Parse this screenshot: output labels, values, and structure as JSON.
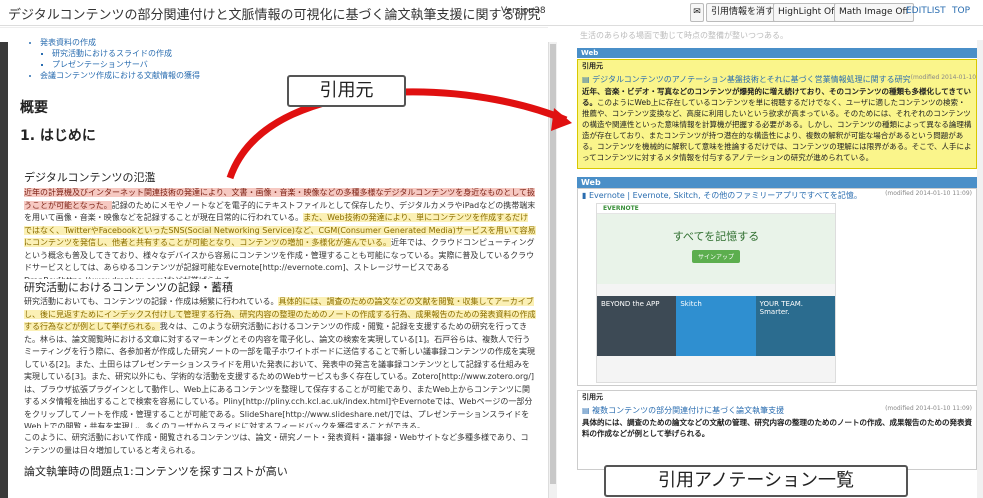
{
  "header": {
    "title": "デジタルコンテンツの部分関連付けと文脈情報の可視化に基づく論文執筆支援に関する研究",
    "version": "Version38",
    "buttons": {
      "clear_citation": "引用情報を消す",
      "highlight_off": "HighLight Off",
      "math_image_off": "Math Image Off"
    },
    "links": {
      "editlist": "EDITLIST",
      "top": "TOP"
    }
  },
  "doc": {
    "toc": [
      "発表資料の作成",
      "研究活動におけるスライドの作成",
      "プレゼンテーションサーバ",
      "会議コンテンツ作成における文献情報の獲得"
    ],
    "h_overview": "概要",
    "h_intro": "1. はじめに",
    "h_flood": "デジタルコンテンツの氾濫",
    "p1_hl": "近年の計算機及びインターネット関連技術の発達により、文書・画像・音楽・映像などの多種多様なデジタルコンテンツを身近なものとして扱うことが可能となった。",
    "p1_rest": "記録のためにメモやノートなどを電子的にテキストファイルとして保存したり、デジタルカメラやiPadなどの携帯端末を用いて画像・音楽・映像などを記録することが現在日常的に行われている。",
    "p1_hl2": "また、Web技術の発達により、単にコンテンツを作成するだけではなく、TwitterやFacebookといったSNS(Social Networking Service)など、CGM(Consumer Generated Media)サービスを用いて容易にコンテンツを発信し、他者と共有することが可能となり、コンテンツの増加・多様化が進んでいる。",
    "p1_tail": "近年では、クラウドコンピューティングという概念も普及してきており、様々なデバイスから容易にコンテンツを作成・管理することも可能になっている。実際に普及しているクラウドサービスとしては、あらゆるコンテンツが記録可能なEvernote[http://evernote.com]、ストレージサービスであるDropBox[https://www.dropbox.com]などが挙げられる。",
    "h_research": "研究活動におけるコンテンツの記録・蓄積",
    "p2": "研究活動においても、コンテンツの記録・作成は頻繁に行われている。",
    "p2_hl": "具体的には、調査のための論文などの文献を閲覧・収集してアーカイブし、後に見返すためにインデックス付けして管理する行為、研究内容の整理のためのノートの作成する行為、成果報告のための発表資料の作成する行為などが例として挙げられる。",
    "p2_rest": "我々は、このような研究活動におけるコンテンツの作成・閲覧・記録を支援するための研究を行ってきた。林らは、論文閲覧時における文章に対するマーキングとその内容を電子化し、論文の検索を実現している[1]。石戸谷らは、複数人で行うミーティングを行う際に、各参加者が作成した研究ノートの一部を電子ホワイトボードに送信することで新しい議事録コンテンツの作成を実現している[2]。また、土田らはプレゼンテーションスライドを用いた発表において、発表中の発言を議事録コンテンツとして記録する仕組みを実現している[3]。また、研究以外にも、学術的な活動を支援するためのWebサービスも多く存在している。Zotero[http://www.zotero.org/]は、ブラウザ拡張プラグインとして動作し、Web上にあるコンテンツを整理して保存することが可能であり、またWeb上からコンテンツに関するメタ情報を抽出することで検索を容易にしている。Pliny[http://pliny.cch.kcl.ac.uk/index.html]やEvernoteでは、Webページの一部分をクリップしてノートを作成・管理することが可能である。SlideShare[http://www.slideshare.net/]では、プレゼンテーションスライドをWeb上での閲覧・共有を実現し、多くのユーザからスライドに対するフィードバックを獲得することができる。",
    "p3": "このように、研究活動において作成・閲覧されるコンテンツは、論文・研究ノート・発表資料・議事録・Webサイトなど多種多様であり、コンテンツの量は日々増加していると考えられる。",
    "h_problem": "論文執筆時の問題点1:コンテンツを探すコストが高い"
  },
  "right": {
    "faded_text": "生活のあらゆる場面で動じて時点の整備が整いつつある。",
    "cardA": {
      "label": "引用元",
      "title": "デジタルコンテンツのアノテーション基盤技術とそれに基づく営業情報処理に関する研究",
      "meta": "(modified 2014-01-10 11:09)",
      "body_bold": "近年、音楽・ビデオ・写真などのコンテンツが爆発的に増え続けており、そのコンテンツの種類も多様化してきている。",
      "body": "このようにWeb上に存在しているコンテンツを単に視聴するだけでなく、ユーザに適したコンテンツの検索・推薦や、コンテンツ変換など、高度に利用したいという欲求が高まっている。そのためには、それぞれのコンテンツの構造や関連性といった意味情報を計算機が把握する必要がある。しかし、コンテンツの種類によって異なる論理構造が存在しており、またコンテンツが持つ潜在的な構造性により、複数の解釈が可能な場合があるという問題がある。コンテンツを機械的に解釈して意味を推論するだけでは、コンテンツの理解には限界がある。そこで、人手によってコンテンツに対するメタ情報を付与するアノテーションの研究が進められている。"
    },
    "cardB": {
      "label": "Web",
      "title": "Evernote | Evernote, Skitch, その他のファミリーアプリですべてを記憶。",
      "meta": "(modified 2014-01-10 11:09)",
      "mock_brand": "EVERNOTE",
      "mock_headline": "すべてを記憶する",
      "mock_button": "サインアップ",
      "tile1": "BEYOND the APP",
      "tile2": "Skitch",
      "tile3": "YOUR TEAM. Smarter."
    },
    "cardC": {
      "label": "引用元",
      "title": "複数コンテンツの部分関連付けに基づく論文執筆支援",
      "meta": "(modified 2014-01-10 11:09)",
      "body_bold": "具体的には、調査のための論文などの文献の管理、研究内容の整理のためのノートの作成、成果報告のための発表資料の作成などが例として挙げられる。"
    }
  },
  "callouts": {
    "source": "引用元",
    "list": "引用アノテーション一覧"
  },
  "colors": {
    "red_highlight": "#f6c9c2",
    "yellow_highlight": "#fbf0b5",
    "card_header_blue": "#4a8fc8",
    "arrow_red": "#e01010"
  }
}
